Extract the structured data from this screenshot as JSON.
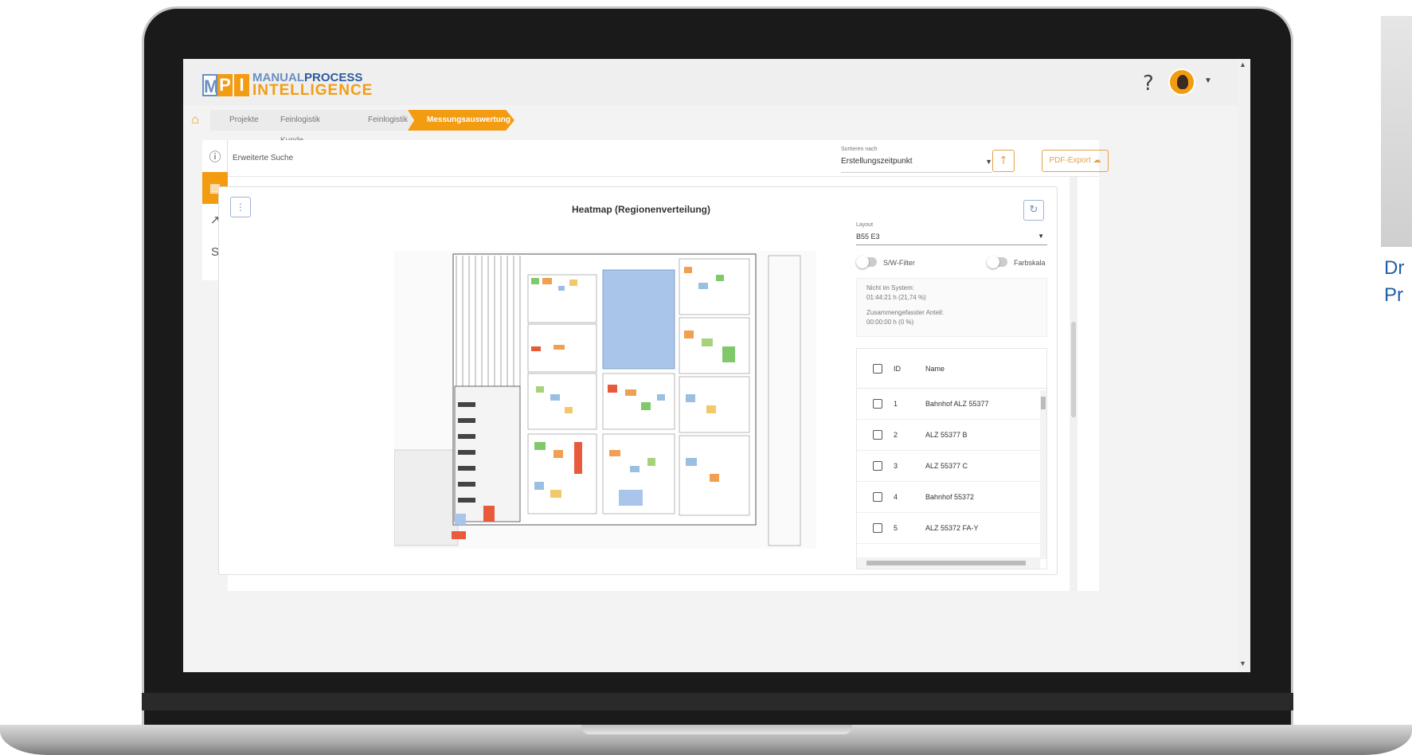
{
  "app": {
    "logo_m": "M",
    "logo_p": "P",
    "logo_i": "I",
    "logo_line1_a": "MANUAL",
    "logo_line1_b": "PROCESS",
    "logo_line2": "INTELLIGENCE",
    "help_label": "?"
  },
  "breadcrumb": [
    "Projekte",
    "Feinlogistik Kunde",
    "Feinlogistik",
    "Messungsauswertung"
  ],
  "toolbar": {
    "search_label": "Erweiterte Suche",
    "sort_label": "Sortieren nach",
    "sort_value": "Erstellungszeitpunkt",
    "pdf_export_label": "PDF-Export"
  },
  "card": {
    "title": "Heatmap (Regionenverteilung)",
    "layout_label": "Layout",
    "layout_value": "B55 E3",
    "sw_filter_label": "S/W-Filter",
    "farbskala_label": "Farbskala",
    "stats": {
      "not_in_system_label": "Nicht im System:",
      "not_in_system_value": "01:44:21 h (21,74 %)",
      "combined_label": "Zusammengefasster Anteil:",
      "combined_value": "00:00:00 h (0 %)"
    },
    "table": {
      "headers": {
        "id": "ID",
        "name": "Name"
      },
      "rows": [
        {
          "id": "1",
          "name": "Bahnhof ALZ 55377"
        },
        {
          "id": "2",
          "name": "ALZ 55377 B"
        },
        {
          "id": "3",
          "name": "ALZ 55377 C"
        },
        {
          "id": "4",
          "name": "Bahnhof 55372"
        },
        {
          "id": "5",
          "name": "ALZ 55372 FA-Y"
        }
      ]
    }
  },
  "side_panel": {
    "line1": "Dr",
    "line2": "Pr"
  },
  "colors": {
    "accent": "#f39c12",
    "brand_blue": "#2d5a9e",
    "side_text": "#1f5ea8"
  }
}
